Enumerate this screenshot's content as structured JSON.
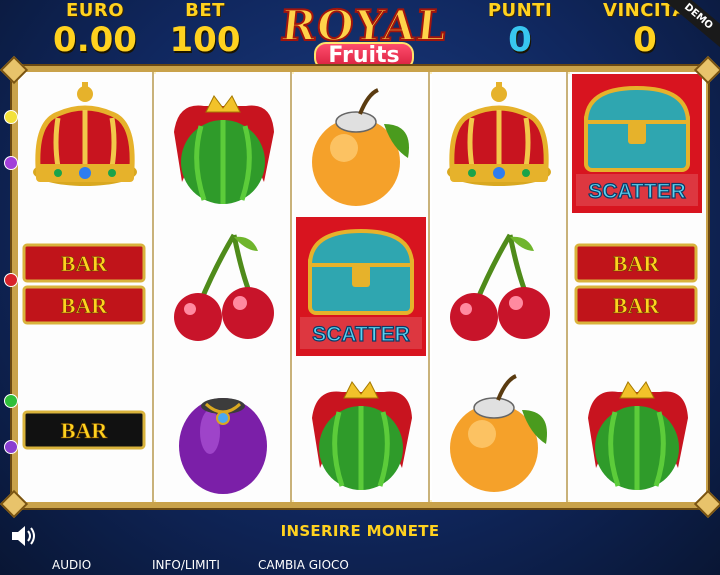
{
  "hud": {
    "euro_label": "EURO",
    "euro_value": "0.00",
    "bet_label": "BET",
    "bet_value": "100",
    "punti_label": "PUNTI",
    "punti_value": "0",
    "vincita_label": "VINCITA",
    "vincita_value": "0",
    "demo_label": "DEMO"
  },
  "logo": {
    "line1": "ROYAL",
    "line2": "Fruits"
  },
  "reels": [
    [
      "crown",
      "bar-double",
      "bar-single"
    ],
    [
      "watermelon",
      "cherries",
      "plum"
    ],
    [
      "orange",
      "scatter",
      "watermelon"
    ],
    [
      "crown",
      "cherries",
      "orange"
    ],
    [
      "scatter",
      "bar-double",
      "watermelon"
    ]
  ],
  "symbols": {
    "bar_text": "BAR",
    "scatter_text": "SCATTER"
  },
  "bottom": {
    "insert_coins": "INSERIRE MONETE",
    "audio": "AUDIO",
    "info": "INFO/LIMITI",
    "change_game": "CAMBIA GIOCO"
  },
  "colors": {
    "accent": "#ffd21f",
    "cyan": "#38c6f0",
    "bar_red": "#c0141a",
    "frame_gold": "#c9a24a"
  }
}
